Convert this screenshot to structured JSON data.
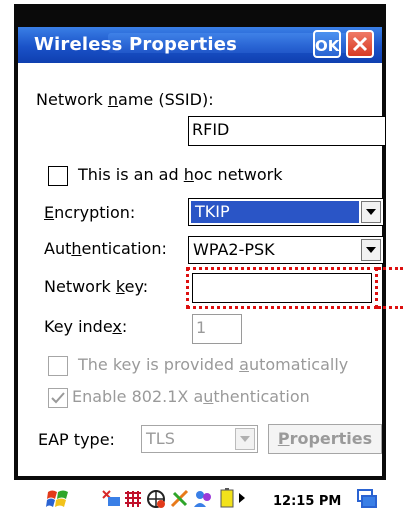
{
  "window": {
    "title": "Wireless Properties",
    "ok_label": "OK"
  },
  "form": {
    "ssid_label_pre": "Network ",
    "ssid_label_u": "n",
    "ssid_label_post": "ame (SSID):",
    "ssid_value": "RFID",
    "adhoc_pre": "This is an ad ",
    "adhoc_u": "h",
    "adhoc_post": "oc network",
    "adhoc_checked": false,
    "enc_label_u": "E",
    "enc_label_post": "ncryption:",
    "enc_value": "TKIP",
    "auth_label_pre": "Aut",
    "auth_label_u": "h",
    "auth_label_post": "entication:",
    "auth_value": "WPA2-PSK",
    "key_label_pre": "Network ",
    "key_label_u": "k",
    "key_label_post": "ey:",
    "key_value": "",
    "index_label_pre": "Key inde",
    "index_label_u": "x",
    "index_label_post": ":",
    "index_value": "1",
    "auto_pre": "The key is provided ",
    "auto_u": "a",
    "auto_post": "utomatically",
    "auto_checked": false,
    "dot1x_pre": "Enable 802.1X a",
    "dot1x_u": "u",
    "dot1x_post": "thentication",
    "dot1x_checked": true,
    "eap_label": "EAP type:",
    "eap_value": "TLS",
    "properties_pre": "",
    "properties_u": "P",
    "properties_post": "roperties"
  },
  "taskbar": {
    "time": "12:15 PM"
  },
  "colors": {
    "titlebar": "#1a52c8",
    "selection": "#2a55c6",
    "highlight": "#dd1010"
  },
  "icons": [
    "start-flag-icon",
    "network-icon",
    "battery-icon",
    "keyboard-icon",
    "clock-arrow-icon",
    "desktop-icon"
  ]
}
